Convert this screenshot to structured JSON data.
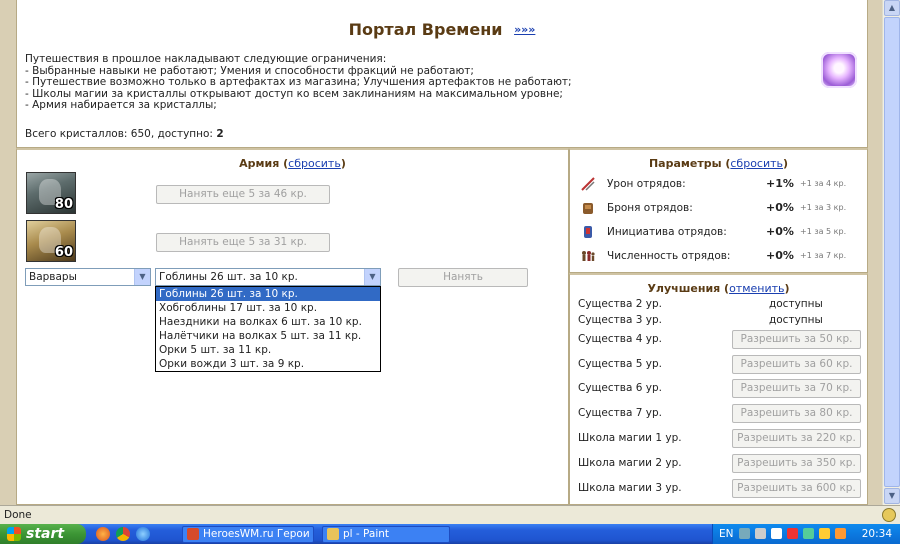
{
  "portal": {
    "title": "Портал Времени",
    "title_link": "»»»",
    "intro": "Путешествия в прошлое накладывают следующие ограничения:",
    "rules": [
      "- Выбранные навыки не работают; Умения и способности фракций не работают;",
      "- Путешествие возможно только в артефактах из магазина; Улучшения артефактов не работают;",
      "- Школы магии за кристаллы открывают доступ ко всем заклинаниям на максимальном уровне;",
      "- Армия набирается за кристаллы;"
    ],
    "crystals_prefix": "Всего кристаллов: 650, доступно:",
    "crystals_available": "2"
  },
  "army": {
    "title": "Армия",
    "reset_link": "сбросить",
    "units": [
      {
        "level": "80",
        "hire_label": "Нанять еще 5 за 46 кр."
      },
      {
        "level": "60",
        "hire_label": "Нанять еще 5 за 31 кр."
      }
    ],
    "faction_select": "Варвары",
    "creature_select": "Гоблины 26 шт. за 10 кр.",
    "hire_button": "Нанять",
    "creature_options": [
      "Гоблины 26 шт. за 10 кр.",
      "Хобгоблины 17 шт. за 10 кр.",
      "Наездники на волках 6 шт. за 10 кр.",
      "Налётчики на волках 5 шт. за 11 кр.",
      "Орки 5 шт. за 11 кр.",
      "Орки вожди 3 шт. за 9 кр."
    ]
  },
  "params": {
    "title": "Параметры",
    "reset_link": "сбросить",
    "rows": [
      {
        "label": "Урон отрядов:",
        "value": "+1%",
        "cost": "+1 за 4 кр.",
        "icon": "damage-icon"
      },
      {
        "label": "Броня отрядов:",
        "value": "+0%",
        "cost": "+1 за 3 кр.",
        "icon": "armor-icon"
      },
      {
        "label": "Инициатива отрядов:",
        "value": "+0%",
        "cost": "+1 за 5 кр.",
        "icon": "initiative-icon"
      },
      {
        "label": "Численность отрядов:",
        "value": "+0%",
        "cost": "+1 за 7 кр.",
        "icon": "numbers-icon"
      }
    ]
  },
  "upgrades": {
    "title": "Улучшения",
    "cancel_link": "отменить",
    "rows": [
      {
        "label": "Существа 2 ур.",
        "status": "доступны"
      },
      {
        "label": "Существа 3 ур.",
        "status": "доступны"
      },
      {
        "label": "Существа 4 ур.",
        "button": "Разрешить за 50 кр."
      },
      {
        "label": "Существа 5 ур.",
        "button": "Разрешить за 60 кр."
      },
      {
        "label": "Существа 6 ур.",
        "button": "Разрешить за 70 кр."
      },
      {
        "label": "Существа 7 ур.",
        "button": "Разрешить за 80 кр."
      },
      {
        "label": "Школа магии 1 ур.",
        "button": "Разрешить за 220 кр."
      },
      {
        "label": "Школа магии 2 ур.",
        "button": "Разрешить за 350 кр."
      },
      {
        "label": "Школа магии 3 ур.",
        "button": "Разрешить за 600 кр."
      }
    ]
  },
  "statusbar": {
    "text": "Done"
  },
  "taskbar": {
    "start": "start",
    "tasks": [
      "HeroesWM.ru Герои ...",
      "pl - Paint"
    ],
    "lang": "EN",
    "clock": "20:34"
  }
}
